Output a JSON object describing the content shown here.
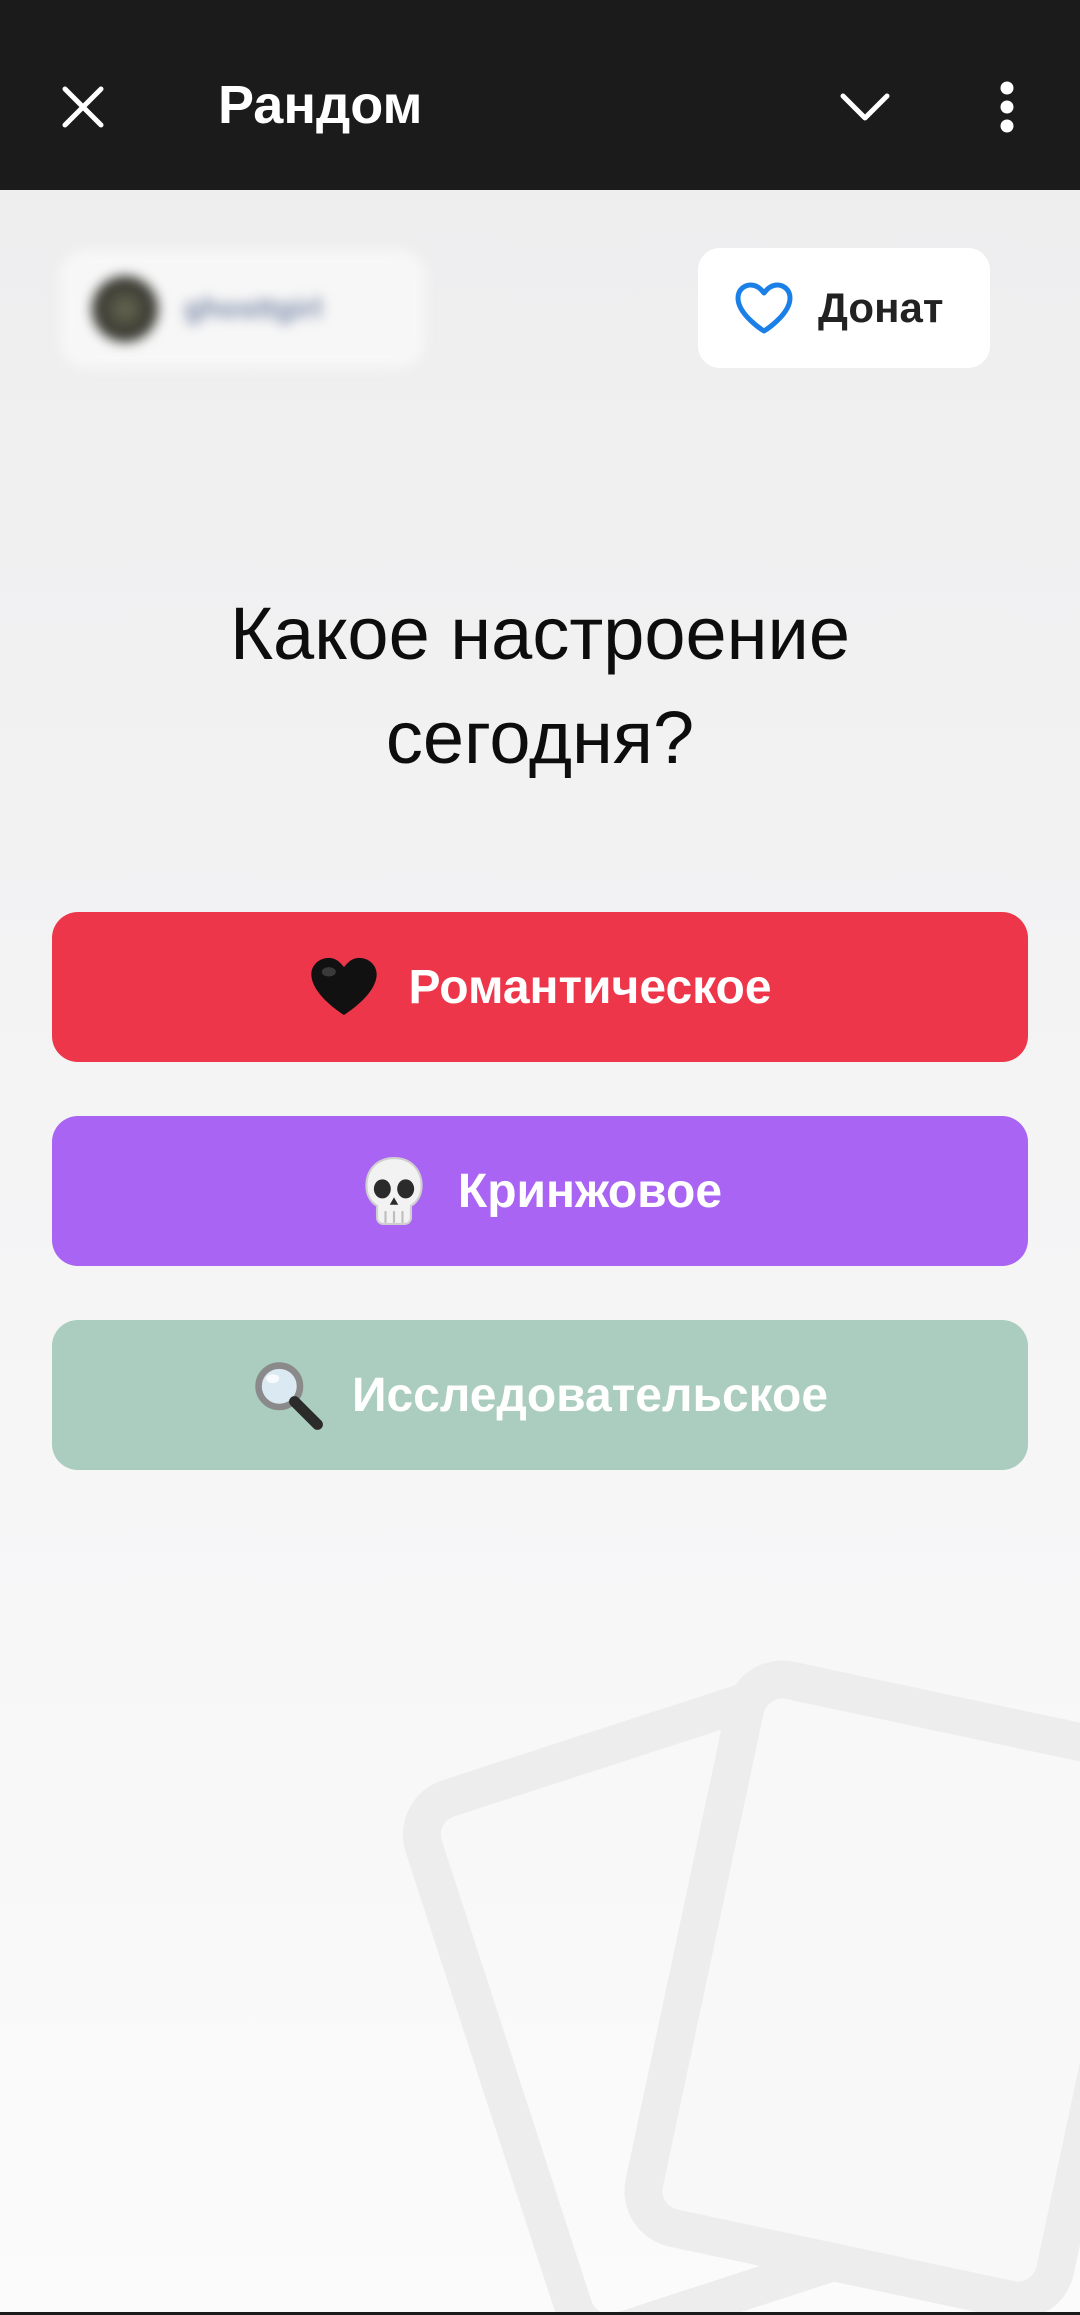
{
  "header": {
    "title": "Рандом",
    "close_icon": "close-icon",
    "collapse_icon": "chevron-down-icon",
    "more_icon": "more-vertical-icon"
  },
  "user_chip": {
    "username": "ghosttgirl"
  },
  "donate": {
    "label": "Донат",
    "icon": "heart-outline-icon",
    "icon_color": "#1a7fe6"
  },
  "question": {
    "line1": "Какое настроение",
    "line2": "сегодня?"
  },
  "options": [
    {
      "label": "Романтическое",
      "emoji": "black-heart",
      "color": "#ed364a"
    },
    {
      "label": "Кринжовое",
      "emoji": "skull",
      "color": "#a964f3"
    },
    {
      "label": "Исследовательское",
      "emoji": "magnifying-glass",
      "color": "#abcdbf"
    }
  ],
  "colors": {
    "topbar": "#1b1b1b",
    "background": "#f0f0f1"
  }
}
